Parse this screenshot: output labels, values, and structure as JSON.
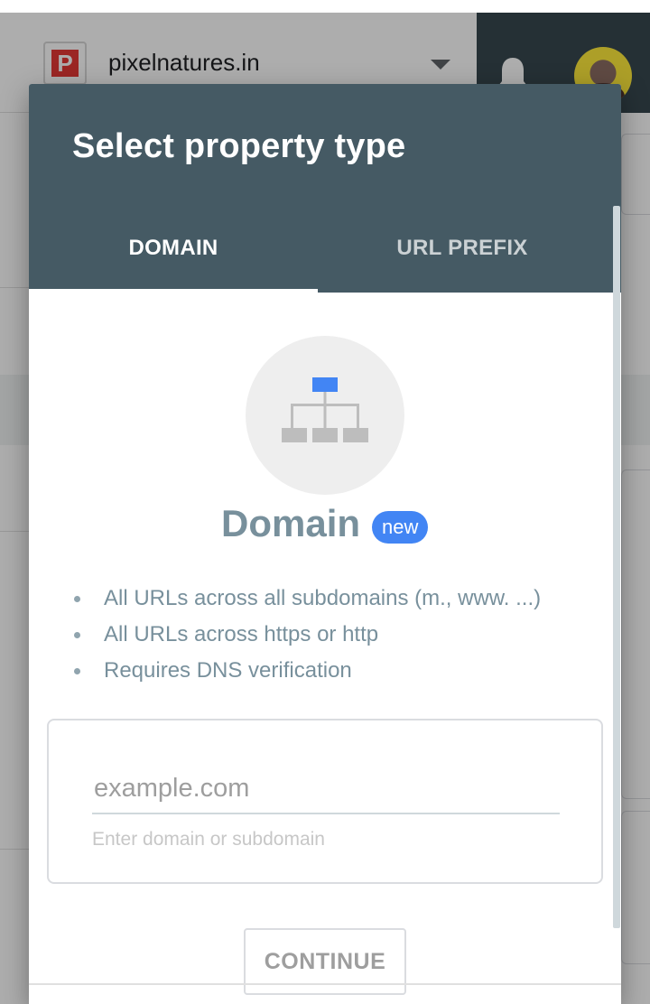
{
  "background": {
    "property": {
      "logo_letter": "P",
      "name": "pixelnatures.in"
    }
  },
  "dialog": {
    "title": "Select property type",
    "tabs": [
      {
        "label": "DOMAIN",
        "active": true
      },
      {
        "label": "URL PREFIX",
        "active": false
      }
    ],
    "option": {
      "heading": "Domain",
      "badge": "new",
      "bullets": [
        "All URLs across all subdomains (m., www. ...)",
        "All URLs across https or http",
        "Requires DNS verification"
      ]
    },
    "input": {
      "value": "",
      "placeholder": "example.com",
      "helper": "Enter domain or subdomain"
    },
    "continue_label": "CONTINUE"
  },
  "colors": {
    "header": "#455a64",
    "accent": "#4285f4",
    "muted_text": "#78909c"
  },
  "icons": {
    "domain_hierarchy": "sitemap-icon",
    "dropdown": "caret-down-icon",
    "notifications": "bell-icon"
  }
}
